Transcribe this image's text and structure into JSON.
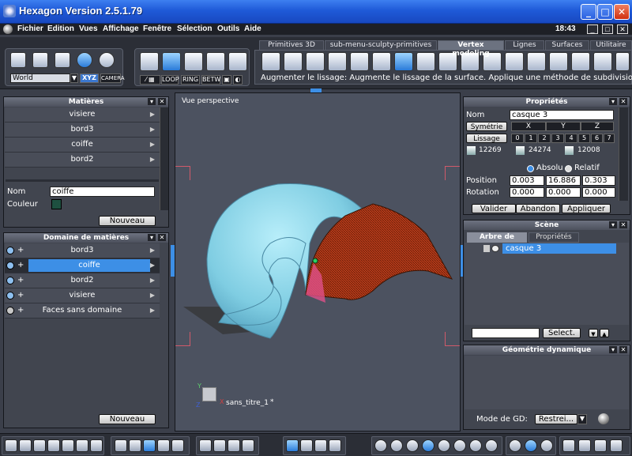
{
  "window": {
    "title": "Hexagon Version 2.5.1.79",
    "min": "_",
    "max": "□",
    "close": "✕"
  },
  "menu": {
    "items": [
      "Fichier",
      "Edition",
      "Vues",
      "Affichage",
      "Fenêtre",
      "Sélection",
      "Outils",
      "Aide"
    ],
    "clock": "18:43"
  },
  "toolbar": {
    "coord_mode": "World",
    "xyz": "XYZ",
    "camera": "CAMERA",
    "loop": "LOOP",
    "ring": "RING",
    "betw": "BETW",
    "tabs": [
      "Primitives 3D",
      "sub-menu-sculpty-primitives",
      "Vertex modeling",
      "Lignes",
      "Surfaces",
      "Utilitaire"
    ],
    "active_tab": "Vertex modeling",
    "status": "Augmenter le lissage: Augmente le lissage de la surface. Applique une méthode de subdivisio"
  },
  "materials": {
    "title": "Matières",
    "items": [
      "visiere",
      "bord3",
      "coiffe",
      "bord2"
    ],
    "nom_label": "Nom",
    "nom_value": "coiffe",
    "couleur_label": "Couleur",
    "color": "#1e5040",
    "new_button": "Nouveau"
  },
  "domains": {
    "title": "Domaine de matières",
    "items": [
      "bord3",
      "coiffe",
      "bord2",
      "visiere",
      "Faces sans domaine"
    ],
    "selected": "coiffe",
    "new_button": "Nouveau"
  },
  "viewport": {
    "label": "Vue perspective",
    "object_name": "sans_titre_1",
    "object_marker": "*",
    "axis_x": "X",
    "axis_y": "Y",
    "axis_z": "Z"
  },
  "properties": {
    "title": "Propriétés",
    "nom_label": "Nom",
    "nom_value": "casque 3",
    "symetrie": "Symétrie",
    "axes": [
      "X",
      "Y",
      "Z"
    ],
    "lissage": "Lissage",
    "levels": [
      "0",
      "1",
      "2",
      "3",
      "4",
      "5",
      "6",
      "7"
    ],
    "counts": [
      "12269",
      "24274",
      "12008"
    ],
    "absolu": "Absolu",
    "relatif": "Relatif",
    "position_label": "Position",
    "position": [
      "0.003",
      "16.886",
      "0.303"
    ],
    "rotation_label": "Rotation",
    "rotation": [
      "0.000",
      "0.000",
      "0.000"
    ],
    "valider": "Valider",
    "abandon": "Abandon",
    "appliquer": "Appliquer"
  },
  "scene": {
    "title": "Scène",
    "tabs": [
      "Arbre de scène",
      "Propriétés"
    ],
    "item": "casque 3",
    "select_button": "Select."
  },
  "geometry": {
    "title": "Géométrie dynamique",
    "mode_label": "Mode de GD:",
    "mode_value": "Restrei..."
  }
}
